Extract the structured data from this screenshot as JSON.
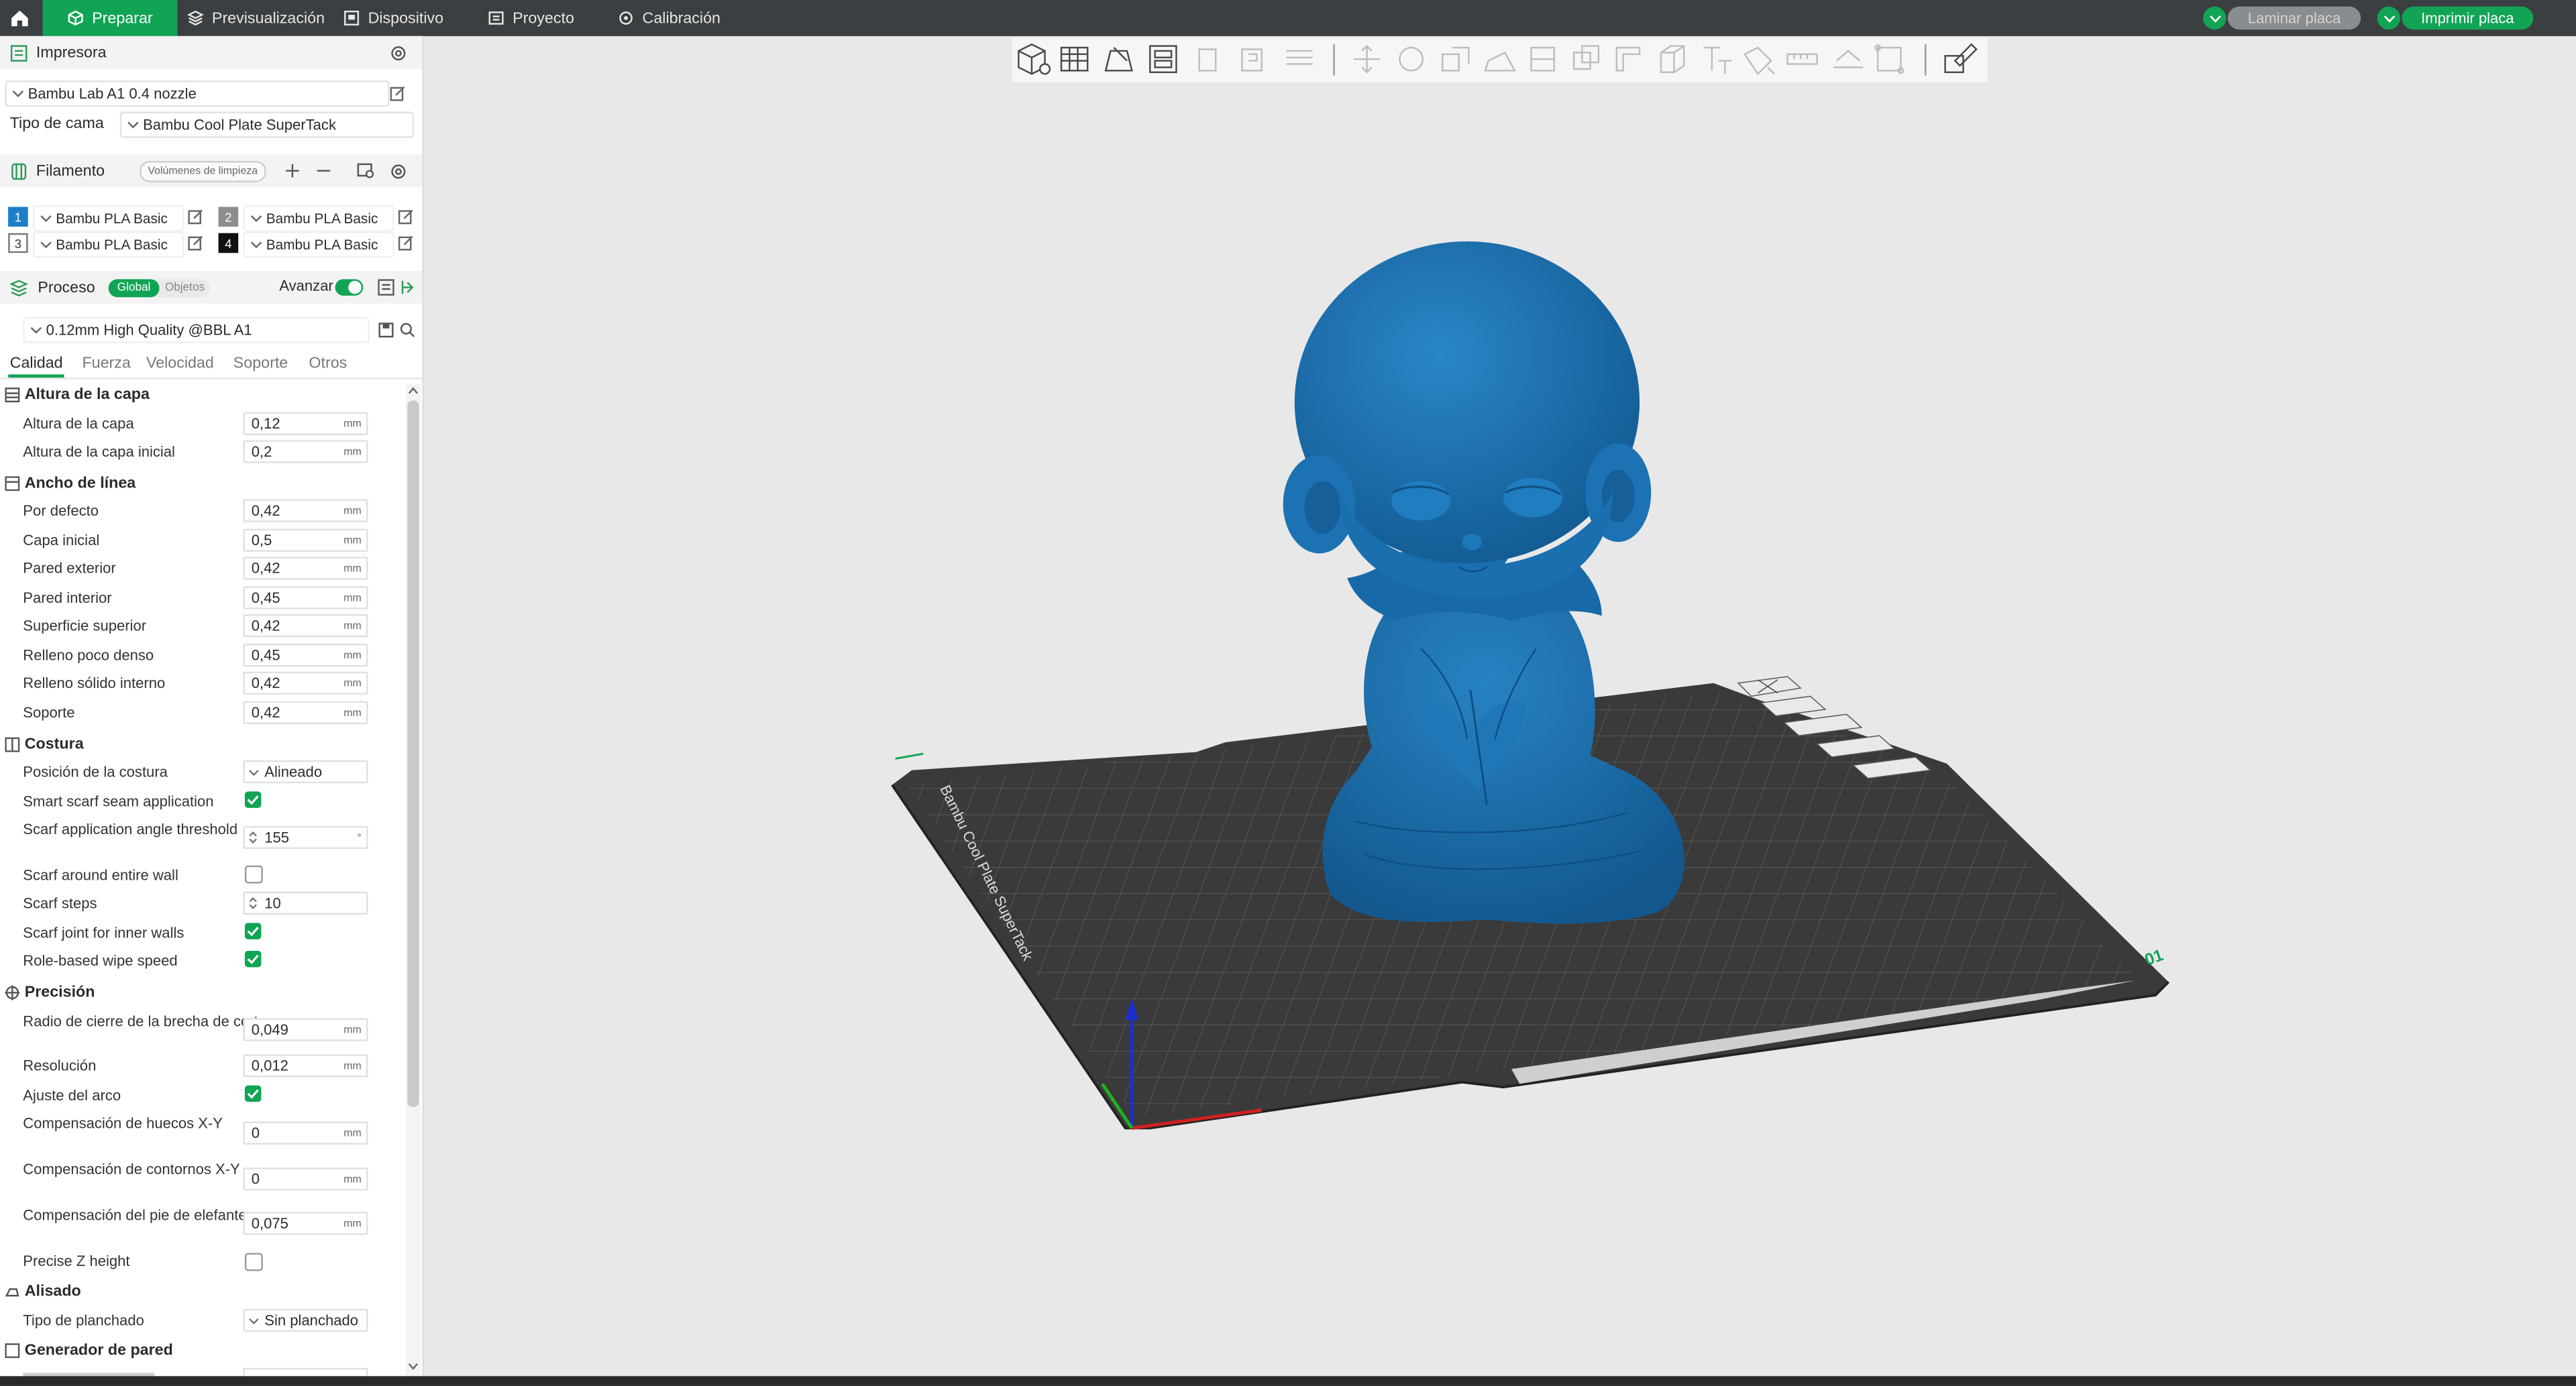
{
  "topbar": {
    "tabs": [
      {
        "label": "Preparar"
      },
      {
        "label": "Previsualización"
      },
      {
        "label": "Dispositivo"
      },
      {
        "label": "Proyecto"
      },
      {
        "label": "Calibración"
      }
    ],
    "slice_button": "Laminar placa",
    "print_button": "Imprimir placa",
    "accent_color": "#11a455"
  },
  "printer": {
    "section_title": "Impresora",
    "printer_name": "Bambu Lab A1 0.4 nozzle",
    "bed_label": "Tipo de cama",
    "bed_value": "Bambu Cool Plate SuperTack"
  },
  "filament": {
    "section_title": "Filamento",
    "flush_button": "Volúmenes de limpieza",
    "items": [
      {
        "num": "1",
        "name": "Bambu PLA Basic",
        "color": "#1e7fc9"
      },
      {
        "num": "2",
        "name": "Bambu PLA Basic",
        "color": "#8d8d8d"
      },
      {
        "num": "3",
        "name": "Bambu PLA Basic",
        "color": "#ffffff"
      },
      {
        "num": "4",
        "name": "Bambu PLA Basic",
        "color": "#111111"
      }
    ]
  },
  "process": {
    "section_title": "Proceso",
    "toggle_global": "Global",
    "toggle_objects": "Objetos",
    "advanced_label": "Avanzar",
    "preset": "0.12mm High Quality @BBL A1",
    "tabs": [
      "Calidad",
      "Fuerza",
      "Velocidad",
      "Soporte",
      "Otros"
    ]
  },
  "settings": {
    "unit": "mm",
    "groups": {
      "layer_height": "Altura de la capa",
      "line_width": "Ancho de línea",
      "seam": "Costura",
      "precision": "Precisión",
      "ironing": "Alisado",
      "wall_generator": "Generador de pared"
    },
    "rows": {
      "layer_height": {
        "label": "Altura de la capa",
        "value": "0,12"
      },
      "initial_layer_height": {
        "label": "Altura de la capa inicial",
        "value": "0,2"
      },
      "default_width": {
        "label": "Por defecto",
        "value": "0,42"
      },
      "initial_layer_width": {
        "label": "Capa inicial",
        "value": "0,5"
      },
      "outer_wall": {
        "label": "Pared exterior",
        "value": "0,42"
      },
      "inner_wall": {
        "label": "Pared interior",
        "value": "0,45"
      },
      "top_surface": {
        "label": "Superficie superior",
        "value": "0,42"
      },
      "sparse_infill": {
        "label": "Relleno poco denso",
        "value": "0,45"
      },
      "solid_infill": {
        "label": "Relleno sólido interno",
        "value": "0,42"
      },
      "support": {
        "label": "Soporte",
        "value": "0,42"
      },
      "seam_position": {
        "label": "Posición de la costura",
        "value": "Alineado"
      },
      "smart_scarf": {
        "label": "Smart scarf seam application",
        "checked": true
      },
      "scarf_angle": {
        "label": "Scarf application angle threshold",
        "value": "155",
        "unit": "°"
      },
      "scarf_entire_wall": {
        "label": "Scarf around entire wall",
        "checked": false
      },
      "scarf_steps": {
        "label": "Scarf steps",
        "value": "10"
      },
      "scarf_inner": {
        "label": "Scarf joint for inner walls",
        "checked": true
      },
      "role_wipe": {
        "label": "Role-based wipe speed",
        "checked": true
      },
      "slice_gap": {
        "label": "Radio de cierre de la brecha de corte",
        "value": "0,049"
      },
      "resolution": {
        "label": "Resolución",
        "value": "0,012"
      },
      "arc_fitting": {
        "label": "Ajuste del arco",
        "checked": true
      },
      "xy_hole": {
        "label": "Compensación de huecos X-Y",
        "value": "0"
      },
      "xy_contour": {
        "label": "Compensación de contornos X-Y",
        "value": "0"
      },
      "elephant_foot": {
        "label": "Compensación del pie de elefante",
        "value": "0,075"
      },
      "precise_z": {
        "label": "Precise Z height",
        "checked": false
      },
      "ironing_type": {
        "label": "Tipo de planchado",
        "value": "Sin planchado"
      }
    }
  },
  "viewport": {
    "plate_text": "Bambu Cool Plate SuperTack",
    "plate_number": "01",
    "model_color": "#1a6fae"
  }
}
